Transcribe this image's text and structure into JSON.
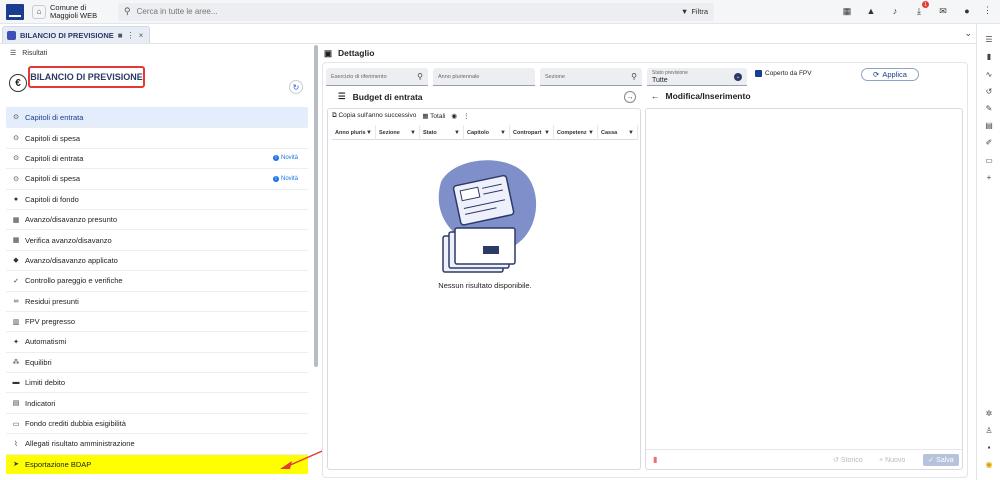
{
  "header": {
    "org_name": "Comune di Maggioli WEB",
    "search_placeholder": "Cerca in tutte le aree...",
    "filter_label": "Filtra",
    "download_badge": "1"
  },
  "tab": {
    "title": "BILANCIO DI PREVISIONE"
  },
  "results_label": "Risultati",
  "left": {
    "title": "BILANCIO DI PREVISIONE",
    "menu": [
      {
        "label": "Capitoli di entrata",
        "icon": "circle-arrow-icon",
        "badge": ""
      },
      {
        "label": "Capitoli di spesa",
        "icon": "circle-arrow-icon",
        "badge": ""
      },
      {
        "label": "Capitoli di entrata",
        "icon": "circle-arrow-icon",
        "badge": "Novità"
      },
      {
        "label": "Capitoli di spesa",
        "icon": "circle-arrow-icon",
        "badge": "Novità"
      },
      {
        "label": "Capitoli di fondo",
        "icon": "coins-icon",
        "badge": ""
      },
      {
        "label": "Avanzo/disavanzo presunto",
        "icon": "calculator-icon",
        "badge": ""
      },
      {
        "label": "Verifica avanzo/disavanzo",
        "icon": "calculator-icon",
        "badge": ""
      },
      {
        "label": "Avanzo/disavanzo applicato",
        "icon": "piggy-bank-icon",
        "badge": ""
      },
      {
        "label": "Controllo pareggio e verifiche",
        "icon": "check-list-icon",
        "badge": ""
      },
      {
        "label": "Residui presunti",
        "icon": "link-icon",
        "badge": ""
      },
      {
        "label": "FPV pregresso",
        "icon": "bank-icon",
        "badge": ""
      },
      {
        "label": "Automatismi",
        "icon": "magic-wand-icon",
        "badge": ""
      },
      {
        "label": "Equilibri",
        "icon": "sitemap-icon",
        "badge": ""
      },
      {
        "label": "Limiti debito",
        "icon": "money-bill-icon",
        "badge": ""
      },
      {
        "label": "Indicatori",
        "icon": "chart-icon",
        "badge": ""
      },
      {
        "label": "Fondo crediti dubbia esigibilità",
        "icon": "document-icon",
        "badge": ""
      },
      {
        "label": "Allegati risultato amministrazione",
        "icon": "paperclip-icon",
        "badge": ""
      },
      {
        "label": "Esportazione BDAP",
        "icon": "send-icon",
        "badge": ""
      }
    ]
  },
  "detail": {
    "title": "Dettaglio",
    "fields": {
      "esercizio": "Esercizio di riferimento",
      "anno_pluriennale": "Anno pluriennale",
      "sezione": "Sezione",
      "stato_label": "Stato previsione",
      "stato_value": "Tutte"
    },
    "coperto_label": "Coperto da FPV",
    "applica_label": "Applica",
    "budget": {
      "title": "Budget di entrata",
      "copy_label": "Copia sull'anno successivo",
      "totals_label": "Totali",
      "columns": [
        "Anno pluris",
        "Sezione",
        "Stato",
        "Capitolo",
        "Contropart",
        "Competenz",
        "Cassa"
      ],
      "empty_message": "Nessun risultato disponibile."
    },
    "modify": {
      "title": "Modifica/Inserimento",
      "storico_label": "Storico",
      "nuovo_label": "Nuovo",
      "salva_label": "Salva"
    }
  },
  "colors": {
    "accent": "#1a3d8f",
    "highlight": "#ffff00",
    "annotation": "#e53935",
    "active_item": "#e3edfb"
  }
}
